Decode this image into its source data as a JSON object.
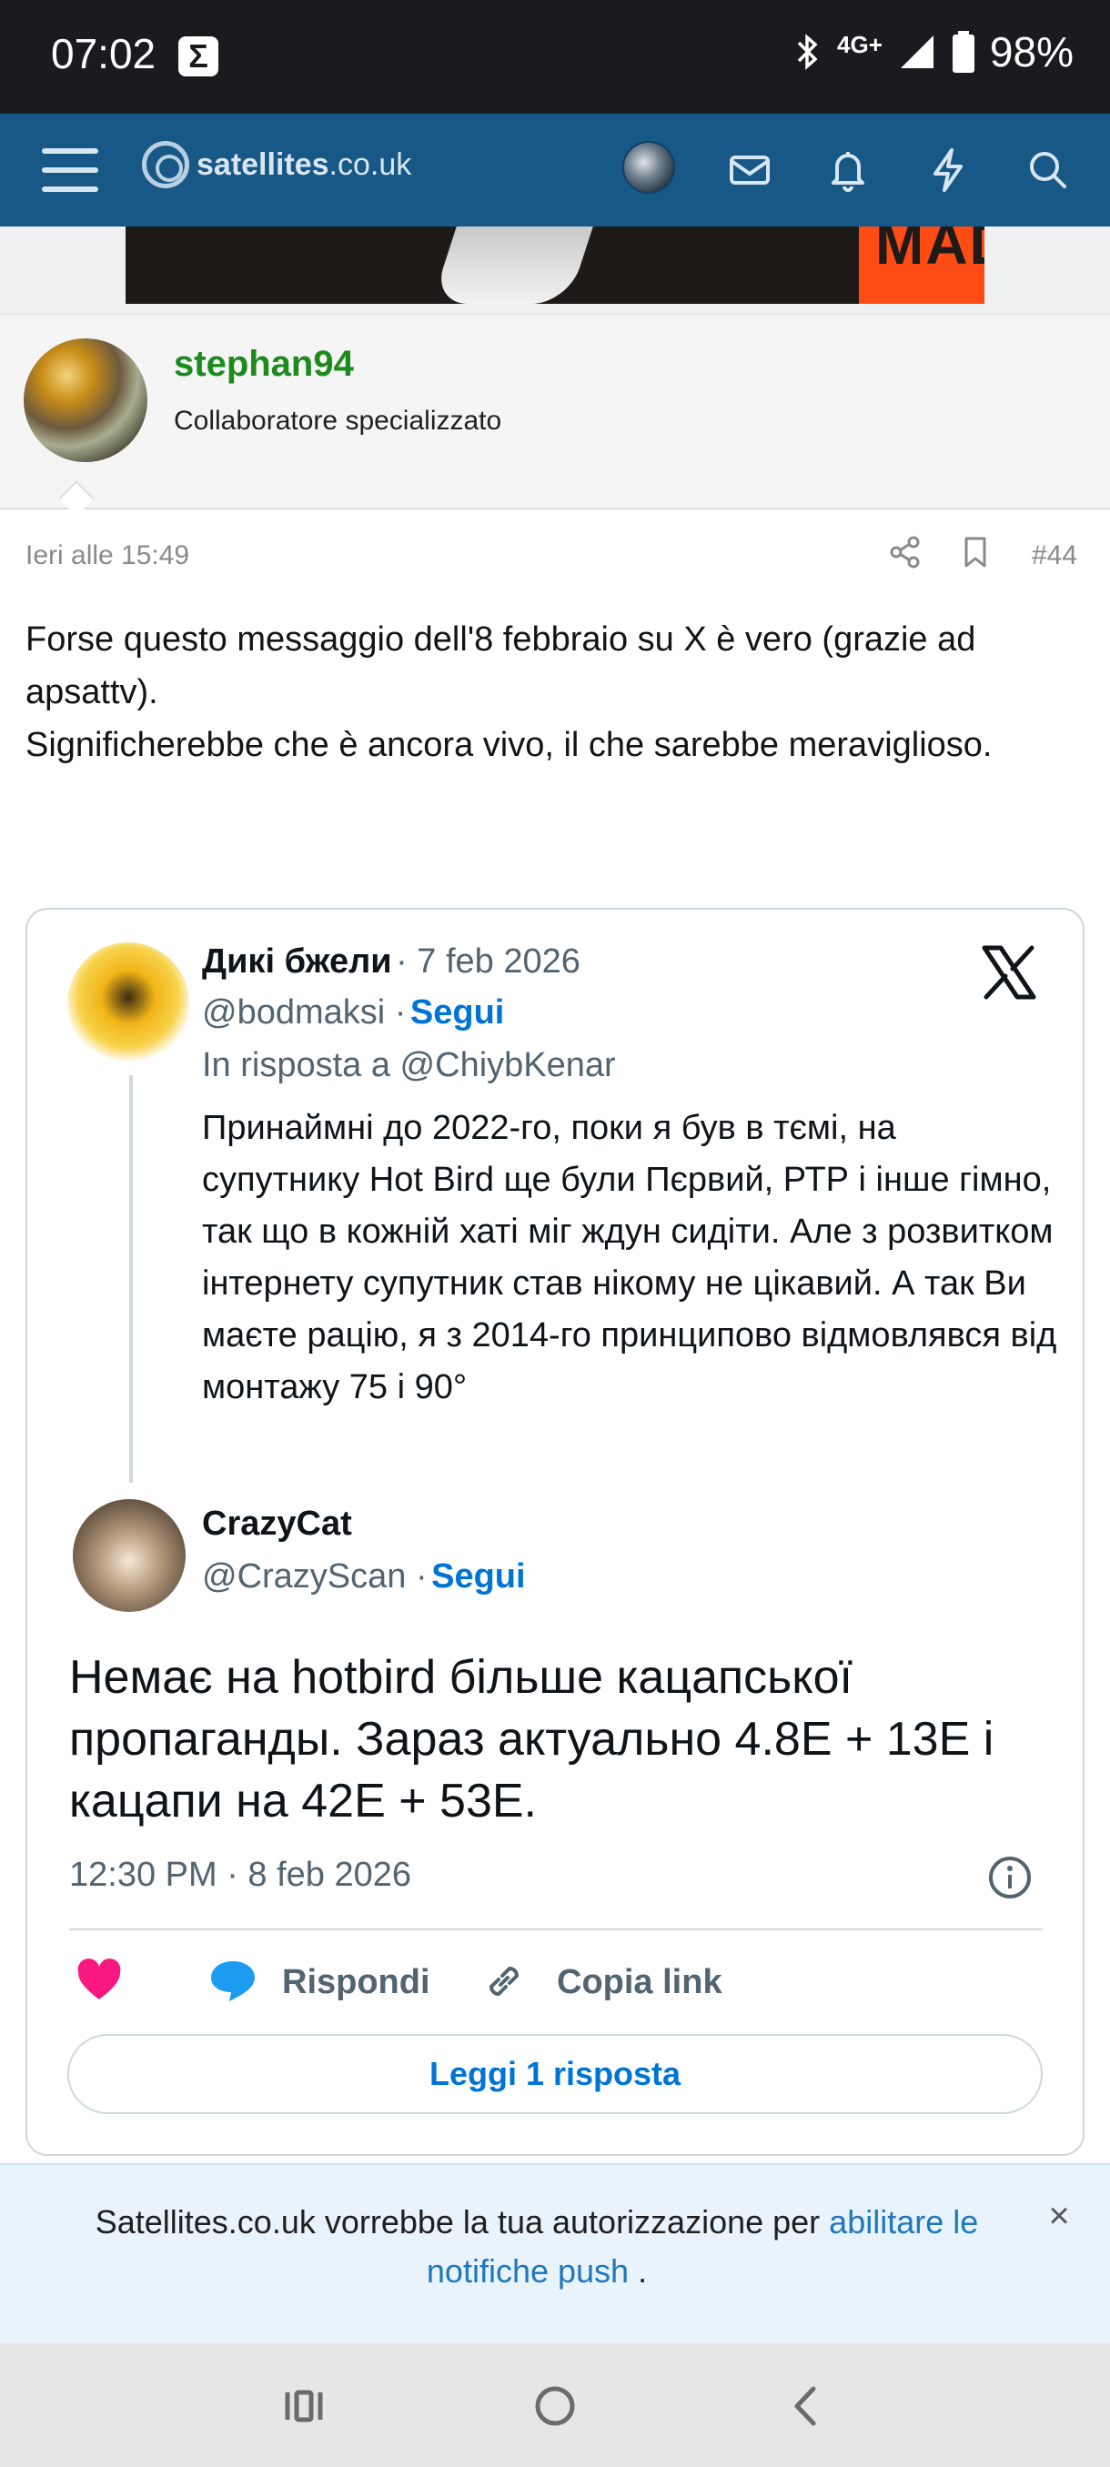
{
  "status_bar": {
    "time": "07:02",
    "sigma": "Σ",
    "network": "4G+",
    "battery": "98%"
  },
  "app_bar": {
    "logo_bold": "satellites",
    "logo_rest": ".co.uk",
    "icons": [
      "menu-icon",
      "avatar",
      "mail-icon",
      "bell-icon",
      "bolt-icon",
      "search-icon"
    ]
  },
  "banner": {
    "text": "MAD"
  },
  "post": {
    "username": "stephan94",
    "user_title": "Collaboratore specializzato",
    "date": "Ieri alle 15:49",
    "number": "#44",
    "body": [
      "Forse questo messaggio dell'8 febbraio su X è vero (grazie ad apsattv).",
      "Significherebbe che è ancora vivo, il che sarebbe meraviglioso."
    ]
  },
  "tweet": {
    "parent": {
      "name": "Дикі бжели",
      "date": "· 7 feb 2026",
      "handle": "@bodmaksi ·",
      "follow": "Segui",
      "reply_to": "In risposta a @ChiybKenar",
      "body": "Принаймні до 2022-го, поки я був в тємі, на супутнику Hot Bird ще були Пєрвий, РТР і інше гімно, так що в кожній хаті міг ждун сидіти. Але з розвитком інтернету супутник став нікому не цікавий.  А так Ви маєте рацію, я з 2014-го принципово відмовлявся від монтажу 75 і 90°"
    },
    "main": {
      "name": "CrazyCat",
      "handle": "@CrazyScan ·",
      "follow": "Segui",
      "body": "Немає на hotbird більше кацапської пропаганды. Зараз актуально 4.8E + 13E і кацапи на 42E + 53E.",
      "timestamp": "12:30 PM · 8 feb 2026"
    },
    "actions": {
      "reply": "Rispondi",
      "copy_link": "Copia link",
      "read_replies": "Leggi 1 risposta"
    }
  },
  "push_notice": {
    "text_before": "Satellites.co.uk vorrebbe la tua autorizzazione per ",
    "link": "abilitare le notifiche push",
    "text_after": " .",
    "close": "×"
  },
  "colors": {
    "app_bar": "#185886",
    "username": "#1d8a1d",
    "link_blue": "#0074d4",
    "heart": "#f91880"
  }
}
